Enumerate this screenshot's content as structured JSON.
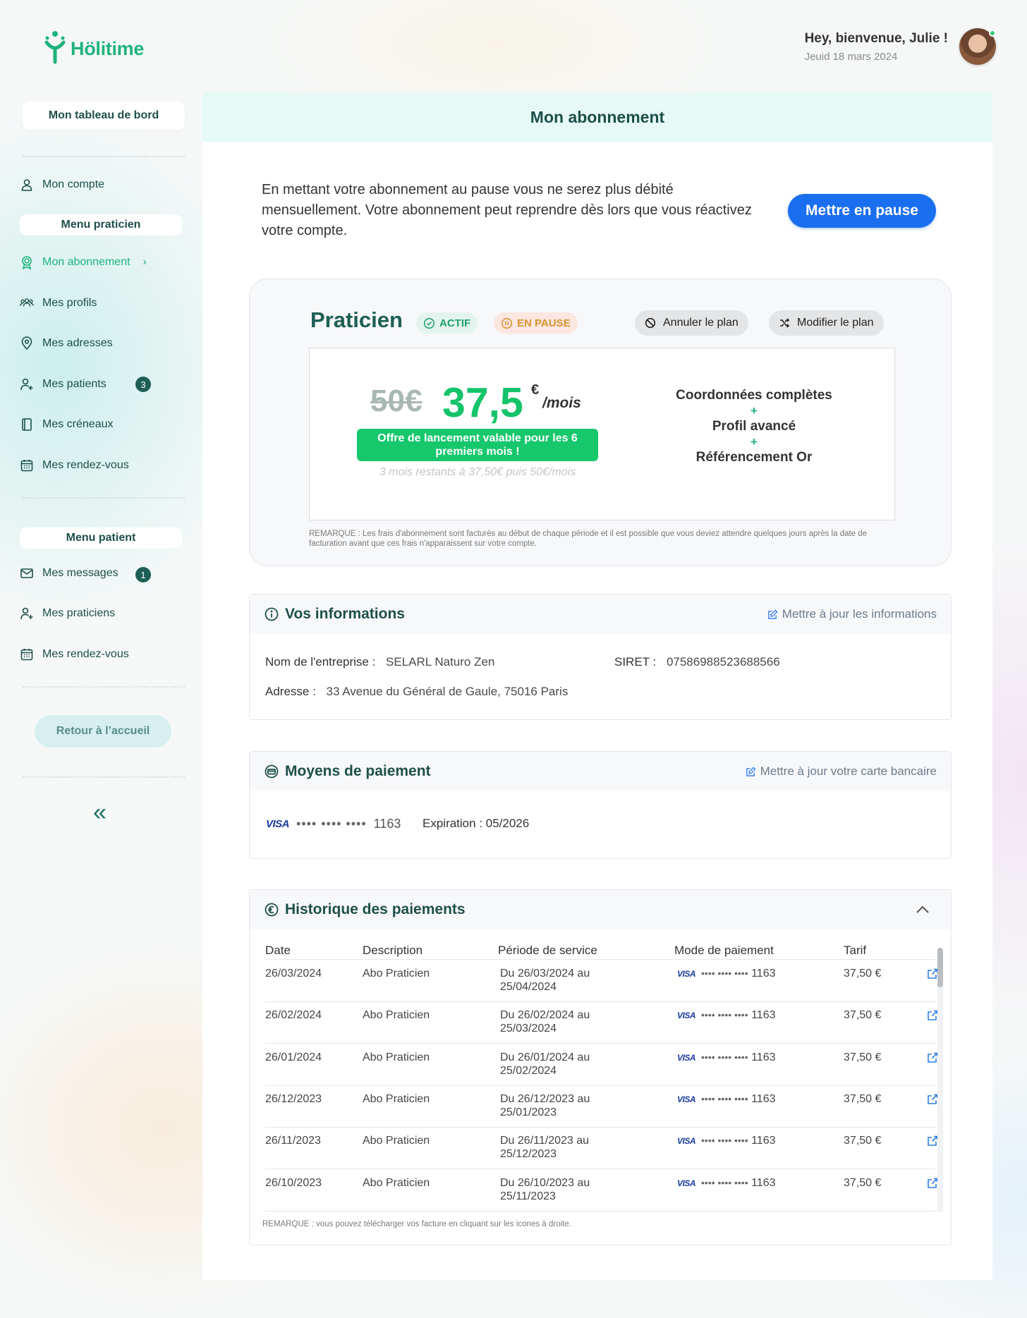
{
  "brand": {
    "name": "Hölitime",
    "color": "#1fb37c"
  },
  "user": {
    "greeting": "Hey, bienvenue, Julie !",
    "date": "Jeuid 18 mars 2024"
  },
  "sidebar": {
    "dashboard": "Mon tableau de bord",
    "account": "Mon compte",
    "practitioner_menu_title": "Menu praticien",
    "practitioner_items": [
      {
        "label": "Mon abonnement",
        "icon": "award-icon",
        "active": true
      },
      {
        "label": "Mes profils",
        "icon": "users-icon"
      },
      {
        "label": "Mes adresses",
        "icon": "map-pin-icon"
      },
      {
        "label": "Mes patients",
        "icon": "user-plus-icon",
        "badge": "3"
      },
      {
        "label": "Mes créneaux",
        "icon": "notebook-icon"
      },
      {
        "label": "Mes rendez-vous",
        "icon": "calendar-icon"
      }
    ],
    "patient_menu_title": "Menu patient",
    "patient_items": [
      {
        "label": "Mes messages",
        "icon": "mail-icon",
        "badge": "1"
      },
      {
        "label": "Mes praticiens",
        "icon": "user-plus-icon"
      },
      {
        "label": "Mes rendez-vous",
        "icon": "calendar-icon"
      }
    ],
    "back_home": "Retour à l’accueil",
    "collapse_icon": "double-chevron-left-icon"
  },
  "main": {
    "title": "Mon abonnement",
    "pause_text": "En mettant votre abonnement au pause vous ne serez plus débité mensuellement. Votre abonnement peut reprendre dès lors que vous réactivez votre compte.",
    "pause_button": "Mettre en pause"
  },
  "plan": {
    "name": "Praticien",
    "status_active": "ACTIF",
    "status_paused": "EN PAUSE",
    "cancel_button": "Annuler le plan",
    "modify_button": "Modifier le plan",
    "old_price": "50€",
    "new_price": "37,5",
    "currency": "€",
    "period": "/mois",
    "offer": "Offre de lancement valable pour les 6 premiers mois !",
    "remaining": "3 mois restants à 37,50€ puis 50€/mois",
    "features": [
      "Coordonnées complètes",
      "Profil avancé",
      "Référencement Or"
    ],
    "plus": "+",
    "note": "REMARQUE : Les frais d'abonnement sont facturés au début de chaque période et il est possible que vous deviez attendre quelques jours après la date de facturation avant que ces frais n'apparaissent sur votre compte.",
    "colors": {
      "price": "#15c46a",
      "title": "#1d5f55"
    }
  },
  "info": {
    "title": "Vos informations",
    "update_link": "Mettre à jour les informations",
    "company_label": "Nom de l'entreprise :",
    "company_value": "SELARL Naturo Zen",
    "siret_label": "SIRET :",
    "siret_value": "07586988523688566",
    "address_label": "Adresse :",
    "address_value": "33 Avenue du Général de Gaule, 75016 Paris"
  },
  "payment": {
    "title": "Moyens de paiement",
    "update_link": "Mettre à jour votre carte bancaire",
    "card_brand": "VISA",
    "card_dots": "•••• •••• ••••",
    "card_last4": "1163",
    "expiration": "Expiration : 05/2026"
  },
  "history": {
    "title": "Historique des paiements",
    "columns": [
      "Date",
      "Description",
      "Période de service",
      "Mode de paiement",
      "Tarif"
    ],
    "rows": [
      {
        "date": "26/03/2024",
        "description": "Abo Praticien",
        "period_1": "Du 26/03/2024 au",
        "period_2": "25/04/2024",
        "brand": "VISA",
        "dots": "•••• •••• ••••",
        "last4": "1163",
        "price": "37,50 €"
      },
      {
        "date": "26/02/2024",
        "description": "Abo Praticien",
        "period_1": "Du 26/02/2024 au",
        "period_2": "25/03/2024",
        "brand": "VISA",
        "dots": "•••• •••• ••••",
        "last4": "1163",
        "price": "37,50 €"
      },
      {
        "date": "26/01/2024",
        "description": "Abo Praticien",
        "period_1": "Du 26/01/2024 au",
        "period_2": "25/02/2024",
        "brand": "VISA",
        "dots": "•••• •••• ••••",
        "last4": "1163",
        "price": "37,50 €"
      },
      {
        "date": "26/12/2023",
        "description": "Abo Praticien",
        "period_1": "Du 26/12/2023 au",
        "period_2": "25/01/2023",
        "brand": "VISA",
        "dots": "•••• •••• ••••",
        "last4": "1163",
        "price": "37,50 €"
      },
      {
        "date": "26/11/2023",
        "description": "Abo Praticien",
        "period_1": "Du 26/11/2023 au",
        "period_2": "25/12/2023",
        "brand": "VISA",
        "dots": "•••• •••• ••••",
        "last4": "1163",
        "price": "37,50 €"
      },
      {
        "date": "26/10/2023",
        "description": "Abo Praticien",
        "period_1": "Du 26/10/2023 au",
        "period_2": "25/11/2023",
        "brand": "VISA",
        "dots": "•••• •••• ••••",
        "last4": "1163",
        "price": "37,50 €"
      }
    ],
    "note": "REMARQUE : vous pouvez télécharger vos facture en cliquant sur les icones à droite.",
    "download_icon": "external-link-icon"
  }
}
